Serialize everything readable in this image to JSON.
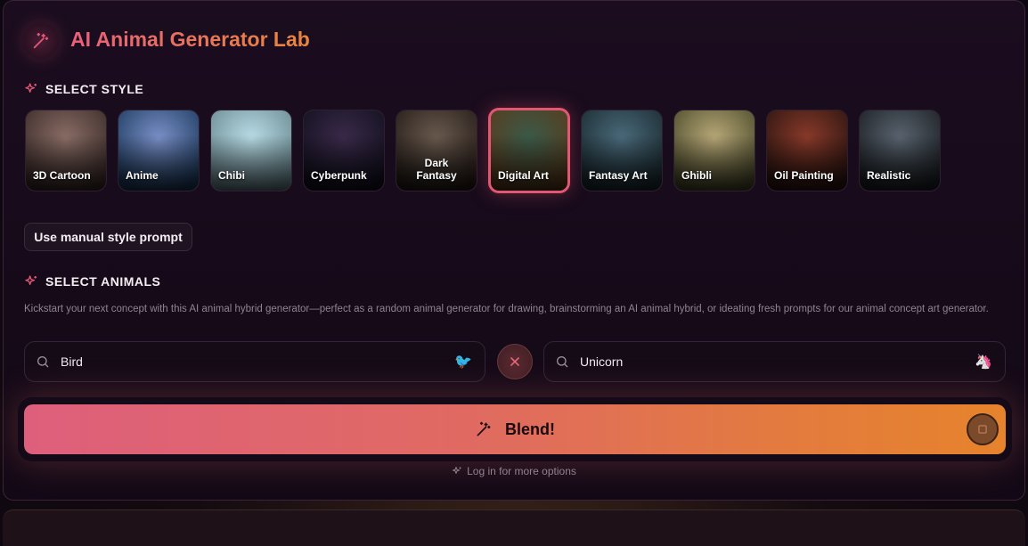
{
  "app": {
    "title": "AI Animal Generator Lab"
  },
  "sections": {
    "style_heading": "SELECT STYLE",
    "animals_heading": "SELECT ANIMALS"
  },
  "styles": [
    {
      "label": "3D Cartoon",
      "colors": [
        "#8a6e66",
        "#3a2a28"
      ]
    },
    {
      "label": "Anime",
      "colors": [
        "#7a90c8",
        "#1c3a5e"
      ]
    },
    {
      "label": "Chibi",
      "colors": [
        "#b8dce6",
        "#6a8890"
      ]
    },
    {
      "label": "Cyberpunk",
      "colors": [
        "#3a2a4a",
        "#12101e"
      ]
    },
    {
      "label": "Dark Fantasy",
      "colors": [
        "#6a5a4e",
        "#241c18"
      ]
    },
    {
      "label": "Digital Art",
      "colors": [
        "#3a5a48",
        "#5a3a1c"
      ],
      "selected": true
    },
    {
      "label": "Fantasy Art",
      "colors": [
        "#4a6a7a",
        "#1a2a30"
      ]
    },
    {
      "label": "Ghibli",
      "colors": [
        "#b8a878",
        "#4a4a2a"
      ]
    },
    {
      "label": "Oil Painting",
      "colors": [
        "#8a3a2a",
        "#2a1410"
      ]
    },
    {
      "label": "Realistic",
      "colors": [
        "#5a6470",
        "#1a1e22"
      ]
    }
  ],
  "manual_style_button": "Use manual style prompt",
  "animals": {
    "description": "Kickstart your next concept with this AI animal hybrid generator—perfect as a random animal generator for drawing, brainstorming an AI animal hybrid, or ideating fresh prompts for our animal concept art generator.",
    "first": {
      "value": "Bird",
      "emoji": "🐦"
    },
    "second": {
      "value": "Unicorn",
      "emoji": "🦄"
    }
  },
  "blend_button": "Blend!",
  "login_hint": "Log in for more options",
  "colors": {
    "accent_pink": "#e05874",
    "accent_orange": "#e6832c"
  }
}
